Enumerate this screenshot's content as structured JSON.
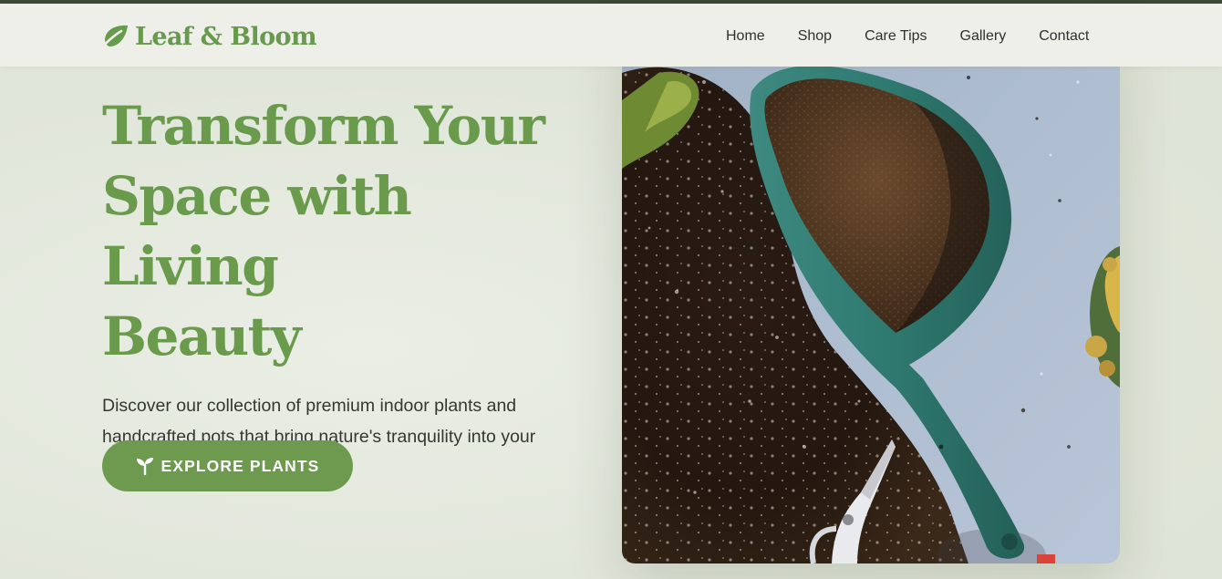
{
  "brand": {
    "name": "Leaf & Bloom",
    "logo_icon": "leaf-icon",
    "color": "#679a4d"
  },
  "nav": {
    "items": [
      {
        "label": "Home"
      },
      {
        "label": "Shop"
      },
      {
        "label": "Care Tips"
      },
      {
        "label": "Gallery"
      },
      {
        "label": "Contact"
      }
    ]
  },
  "hero": {
    "title_lines": [
      "Transform Your",
      "Space with Living",
      "Beauty"
    ],
    "description": "Discover our collection of premium indoor plants and handcrafted pots that bring nature's tranquility into your home.",
    "cta": {
      "label": "EXPLORE PLANTS",
      "icon": "seedling-icon"
    },
    "image_subject": "green garden trowel with soil, moss and pruning shears on a blue-grey surface"
  },
  "colors": {
    "accent_green": "#6a9a4c",
    "button_green": "#6d9a4e",
    "navbar_bg": "#efefea",
    "page_bg": "#e2e7dc",
    "text_dark": "#333833"
  }
}
